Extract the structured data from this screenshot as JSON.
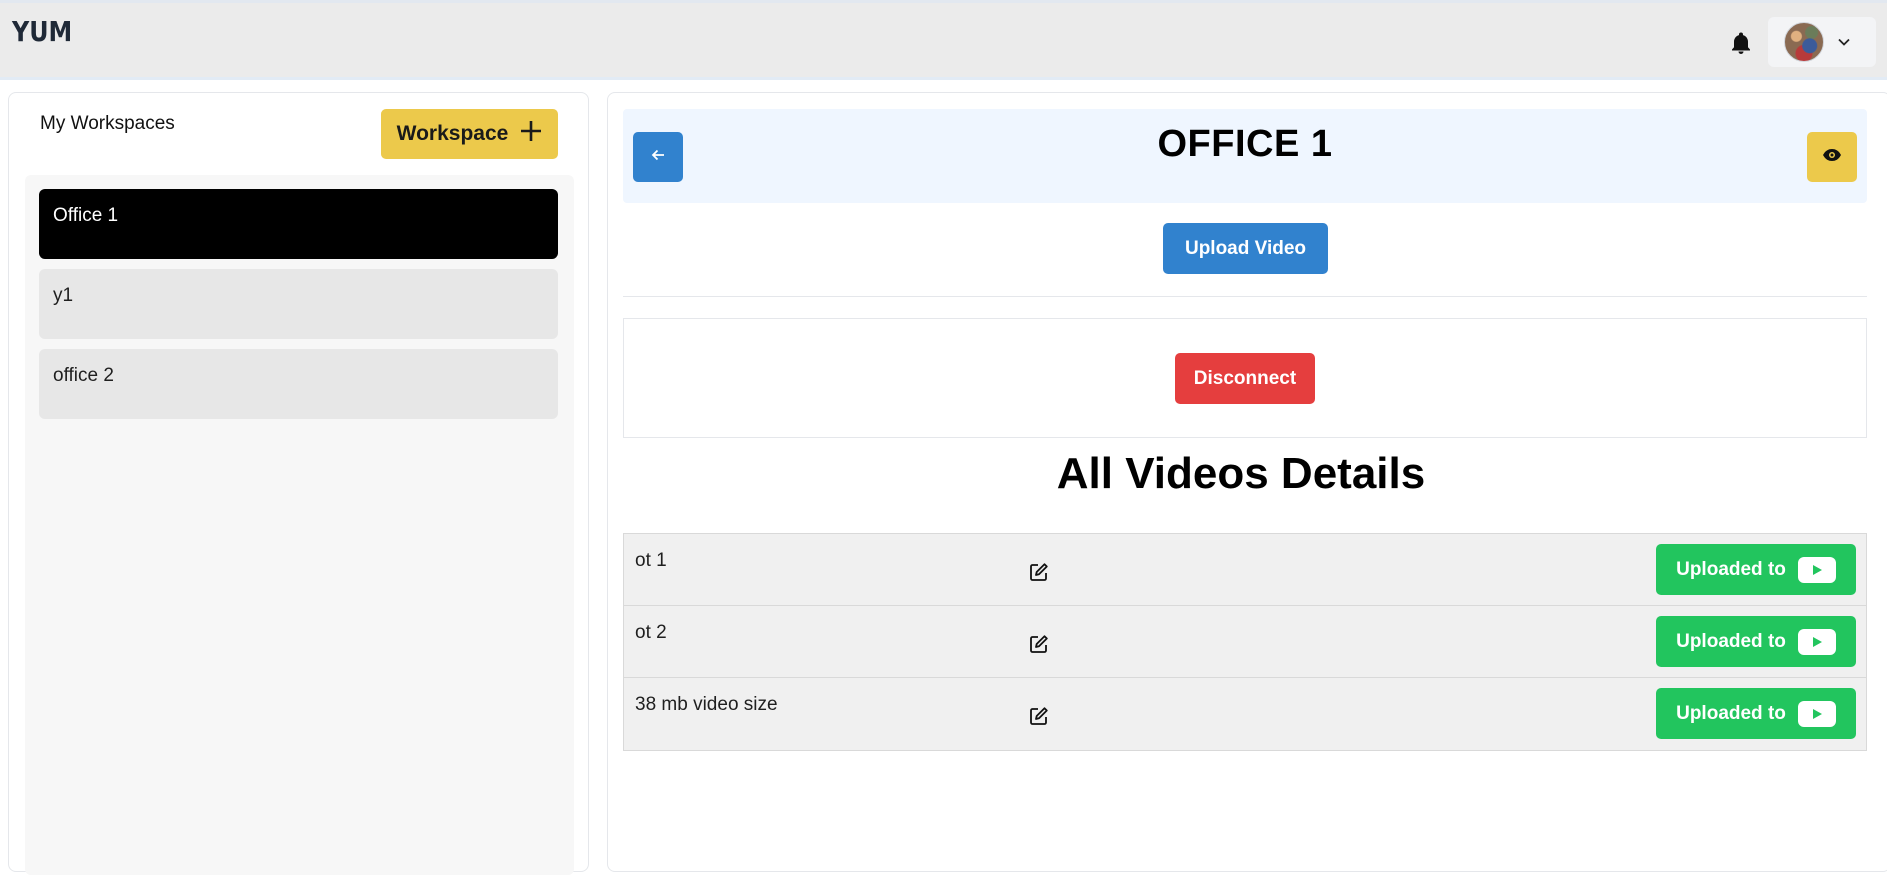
{
  "header": {
    "logo": "YUM",
    "notifications_icon": "bell-icon",
    "profile_menu_icon": "chevron-down-icon"
  },
  "sidebar": {
    "title": "My Workspaces",
    "add_workspace_label": "Workspace",
    "add_icon": "plus-icon",
    "items": [
      {
        "label": "Office 1",
        "active": true
      },
      {
        "label": "y1",
        "active": false
      },
      {
        "label": "office 2",
        "active": false
      }
    ]
  },
  "main": {
    "title": "OFFICE 1",
    "back_icon": "arrow-left-icon",
    "view_icon": "eye-icon",
    "upload_label": "Upload Video",
    "disconnect_label": "Disconnect",
    "section_title": "All Videos Details",
    "videos": [
      {
        "name": "ot 1",
        "status_label": "Uploaded to"
      },
      {
        "name": "ot 2",
        "status_label": "Uploaded to"
      },
      {
        "name": "38 mb video size",
        "status_label": "Uploaded to"
      }
    ]
  },
  "colors": {
    "brand_yellow": "#ecc94b",
    "primary_blue": "#3182ce",
    "danger_red": "#e53e3e",
    "success_green": "#22c55e",
    "active_item": "#000000"
  }
}
